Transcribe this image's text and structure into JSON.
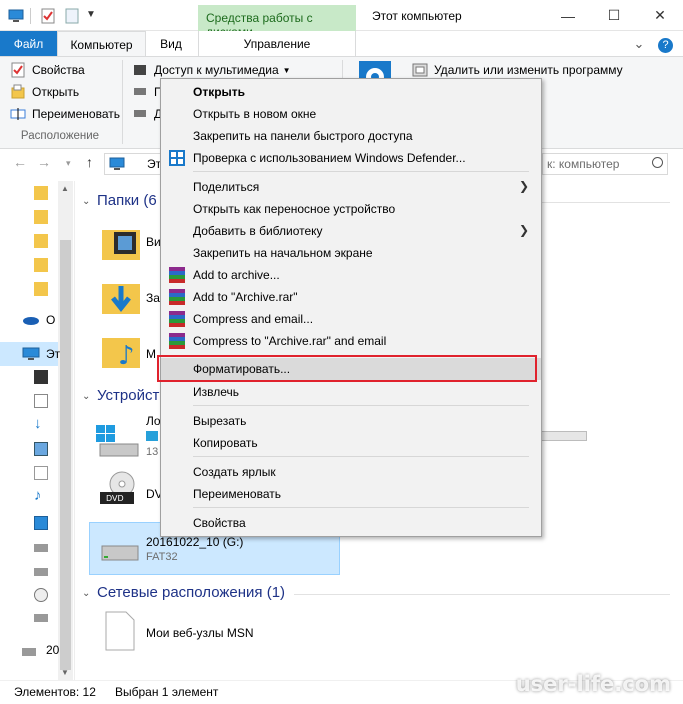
{
  "window": {
    "tools_tab": "Средства работы с дисками",
    "title": "Этот компьютер",
    "minimize": "—",
    "maximize": "☐",
    "close": "✕"
  },
  "ribbon_tabs": {
    "file": "Файл",
    "computer": "Компьютер",
    "view": "Вид",
    "manage": "Управление"
  },
  "ribbon": {
    "properties": "Свойства",
    "open": "Открыть",
    "rename": "Переименовать",
    "group_location": "Расположение",
    "media_access": "Доступ к мультимедиа",
    "map_drive_partial": "П",
    "add_location_partial": "Д",
    "uninstall": "Удалить или изменить программу"
  },
  "address": {
    "crumb_partial": "Эт",
    "search_placeholder": "к: компьютер"
  },
  "content": {
    "folders_group": "Папки (6",
    "devices_group": "Устройст",
    "network_group": "Сетевые расположения (1)",
    "folder_items": [
      "Ви",
      "За",
      "М"
    ],
    "drive_local_partial": "Ло",
    "drive_local_sub_partial": "13",
    "drive_dvd_partial": "DV",
    "selected_drive_name": "20161022_10 (G:)",
    "selected_drive_fs": "FAT32",
    "network_item": "Мои веб-узлы MSN"
  },
  "navpane": {
    "onedrive_partial": "О",
    "this_pc_partial": "Эт",
    "drive_partial": "20"
  },
  "context_menu": {
    "items": [
      {
        "label": "Открыть",
        "bold": true
      },
      {
        "label": "Открыть в новом окне"
      },
      {
        "label": "Закрепить на панели быстрого доступа"
      },
      {
        "label": "Проверка с использованием Windows Defender..."
      },
      {
        "label": "Поделиться"
      },
      {
        "label": "Открыть как переносное устройство"
      },
      {
        "label": "Добавить в библиотеку"
      },
      {
        "label": "Закрепить на начальном экране"
      },
      {
        "label": "Add to archive..."
      },
      {
        "label": "Add to \"Archive.rar\""
      },
      {
        "label": "Compress and email..."
      },
      {
        "label": "Compress to \"Archive.rar\" and email"
      },
      {
        "label": "Форматировать..."
      },
      {
        "label": "Извлечь"
      },
      {
        "label": "Вырезать"
      },
      {
        "label": "Копировать"
      },
      {
        "label": "Создать ярлык"
      },
      {
        "label": "Переименовать"
      },
      {
        "label": "Свойства"
      }
    ]
  },
  "status": {
    "items_count": "Элементов: 12",
    "selected": "Выбран 1 элемент"
  },
  "watermark": "user-life.com",
  "colors": {
    "accent": "#1979ca",
    "tools_tab_bg": "#c8e9c8",
    "selection_bg": "#cce8ff",
    "highlight_border": "#e0222d",
    "group_title": "#1e3287"
  }
}
